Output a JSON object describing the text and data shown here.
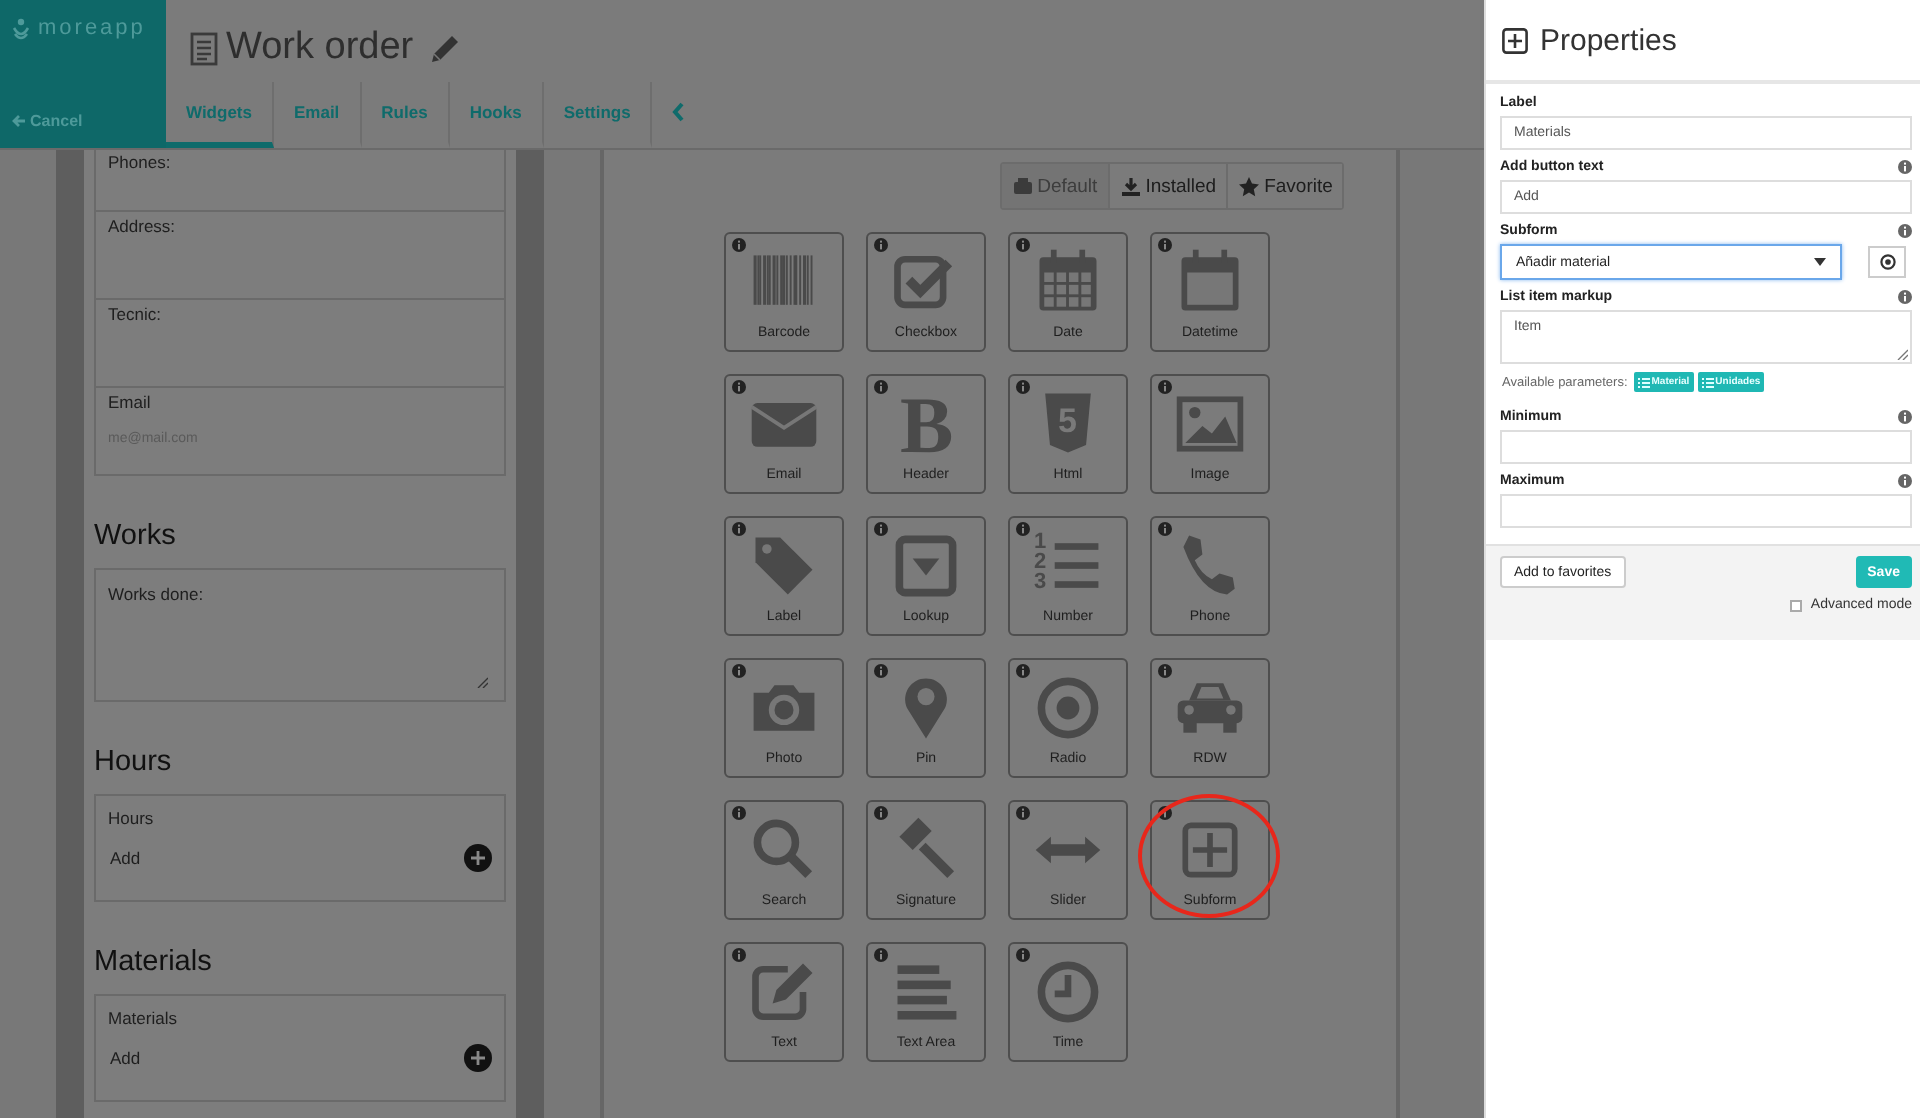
{
  "app": {
    "logo": "moreapp",
    "cancel": "Cancel"
  },
  "title": "Work order",
  "tabs": [
    {
      "label": "Widgets",
      "selected": true
    },
    {
      "label": "Email",
      "selected": false
    },
    {
      "label": "Rules",
      "selected": false
    },
    {
      "label": "Hooks",
      "selected": false
    },
    {
      "label": "Settings",
      "selected": false
    }
  ],
  "preview": [
    {
      "kind": "field",
      "label": "Phones:"
    },
    {
      "kind": "field",
      "label": "Address:"
    },
    {
      "kind": "field",
      "label": "Tecnic:"
    },
    {
      "kind": "field",
      "label": "Email",
      "placeholder": "me@mail.com"
    },
    {
      "kind": "heading",
      "label": "Works"
    },
    {
      "kind": "textarea",
      "label": "Works done:"
    },
    {
      "kind": "heading",
      "label": "Hours"
    },
    {
      "kind": "subform",
      "label": "Hours",
      "add": "Add"
    },
    {
      "kind": "heading",
      "label": "Materials"
    },
    {
      "kind": "subform",
      "label": "Materials",
      "add": "Add"
    }
  ],
  "widget_filters": [
    {
      "label": "Default",
      "selected": true
    },
    {
      "label": "Installed",
      "selected": false
    },
    {
      "label": "Favorite",
      "selected": false
    }
  ],
  "widgets": [
    {
      "label": "Barcode",
      "highlighted": false
    },
    {
      "label": "Checkbox",
      "highlighted": false
    },
    {
      "label": "Date",
      "highlighted": false
    },
    {
      "label": "Datetime",
      "highlighted": false
    },
    {
      "label": "Email",
      "highlighted": false
    },
    {
      "label": "Header",
      "highlighted": false,
      "glyphs": [
        "B"
      ]
    },
    {
      "label": "Html",
      "highlighted": false,
      "glyphs": [
        "5"
      ]
    },
    {
      "label": "Image",
      "highlighted": false
    },
    {
      "label": "Label",
      "highlighted": false
    },
    {
      "label": "Lookup",
      "highlighted": false
    },
    {
      "label": "Number",
      "highlighted": false,
      "glyphs": [
        "1",
        "2",
        "3"
      ]
    },
    {
      "label": "Phone",
      "highlighted": false
    },
    {
      "label": "Photo",
      "highlighted": false
    },
    {
      "label": "Pin",
      "highlighted": false
    },
    {
      "label": "Radio",
      "highlighted": false
    },
    {
      "label": "RDW",
      "highlighted": false
    },
    {
      "label": "Search",
      "highlighted": false
    },
    {
      "label": "Signature",
      "highlighted": false
    },
    {
      "label": "Slider",
      "highlighted": false
    },
    {
      "label": "Subform",
      "highlighted": true
    },
    {
      "label": "Text",
      "highlighted": false
    },
    {
      "label": "Text Area",
      "highlighted": false
    },
    {
      "label": "Time",
      "highlighted": false
    }
  ],
  "properties": {
    "title": "Properties",
    "fields": [
      {
        "kind": "input",
        "label": "Label",
        "value": "Materials",
        "info": false
      },
      {
        "kind": "input",
        "label": "Add button text",
        "value": "Add",
        "info": true
      },
      {
        "kind": "select",
        "label": "Subform",
        "value": "Añadir material",
        "info": true,
        "focused": true
      },
      {
        "kind": "textarea",
        "label": "List item markup",
        "value": "Item",
        "info": true
      },
      {
        "kind": "params",
        "label": "Available parameters:",
        "tags": [
          "Material",
          "Unidades"
        ]
      },
      {
        "kind": "input",
        "label": "Minimum",
        "info": true
      },
      {
        "kind": "input",
        "label": "Maximum",
        "info": true
      }
    ],
    "favorites_button": "Add to favorites",
    "save_button": "Save",
    "advanced_mode": {
      "label": "Advanced mode",
      "checked": false
    }
  }
}
